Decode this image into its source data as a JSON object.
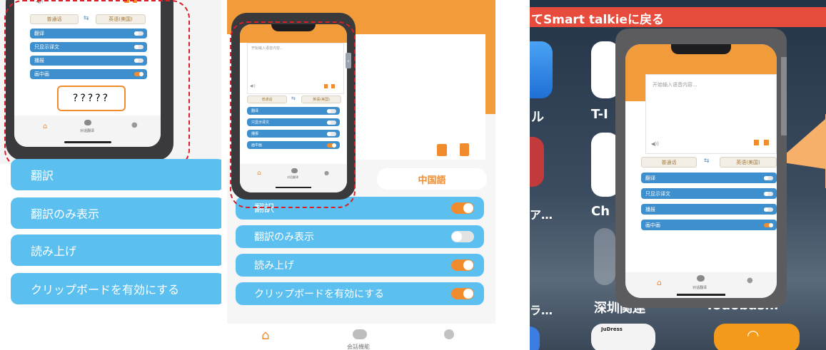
{
  "panel1": {
    "list": [
      "翻訳",
      "翻訳のみ表示",
      "読み上げ",
      "クリップボードを有効にする"
    ],
    "mini_rows": [
      "翻译",
      "只显示译文",
      "播报",
      "画中画"
    ],
    "lang_from": "普通话",
    "lang_to": "英语(美国)",
    "question_box": "?????",
    "nav_center": "对话翻译"
  },
  "panel2": {
    "language_pill": "中国語",
    "list": [
      "翻訳",
      "翻訳のみ表示",
      "読み上げ",
      "クリップボードを有効にする"
    ],
    "mini_rows": [
      "翻译",
      "只显示译文",
      "播报",
      "画中画"
    ],
    "mini_input_placeholder": "开始输入语音内容...",
    "lang_from": "普通话",
    "lang_to": "英语(美国)",
    "nav_center": "对话翻译",
    "bottom_nav_center": "会話機能"
  },
  "panel3": {
    "banner": "てSmart talkieに戻る",
    "app_labels": [
      "ル",
      "T-I",
      "ア…",
      "Ch",
      "ラ…",
      "深圳関連",
      "Todobashi",
      "JuDress"
    ],
    "mini_input_placeholder": "开始输入语音内容...",
    "mini_rows": [
      "翻译",
      "只显示译文",
      "播报",
      "画中画"
    ],
    "lang_from": "普通话",
    "lang_to": "英语(美国)",
    "nav_center": "对话翻译"
  },
  "colors": {
    "accent_orange": "#f08c2e",
    "row_blue": "#5bc0ef",
    "mini_blue": "#3d8fce",
    "dash_red": "#d8202a",
    "banner_red": "#e64b3c"
  }
}
